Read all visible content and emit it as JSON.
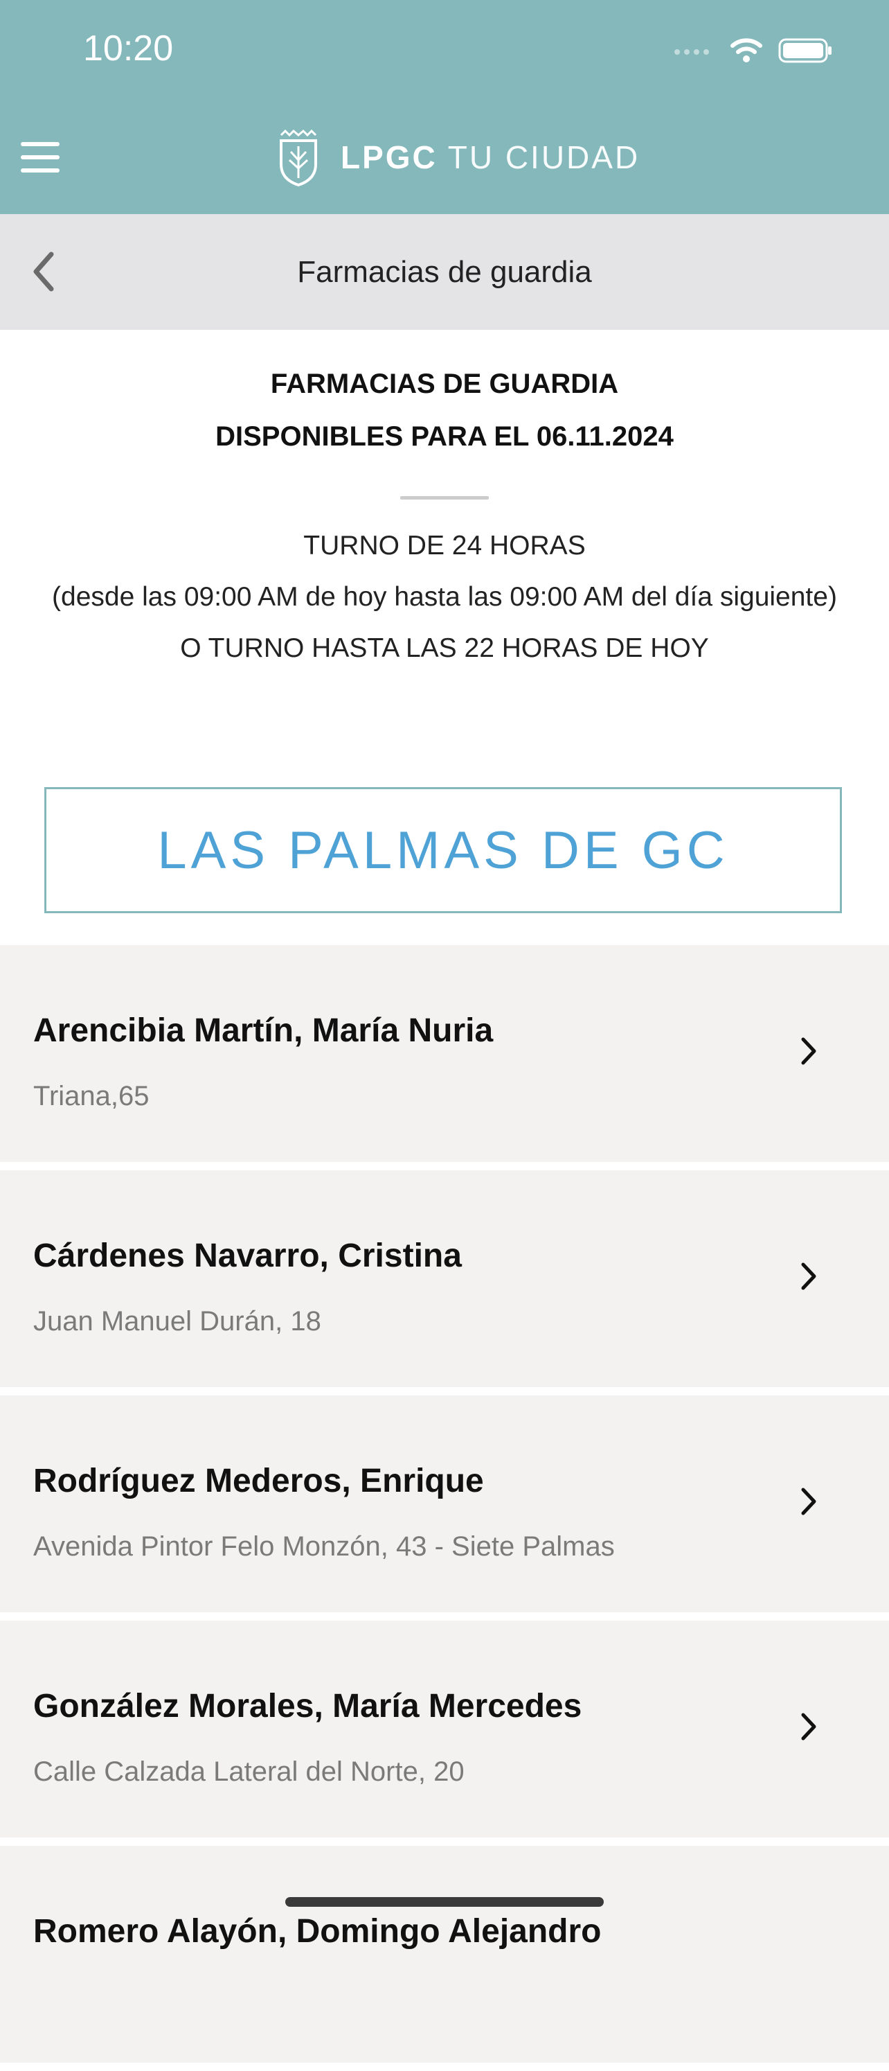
{
  "status_bar": {
    "time": "10:20",
    "icons": [
      "signal-icon",
      "wifi-icon",
      "battery-icon"
    ]
  },
  "header": {
    "brand_bold": "LPGC",
    "brand_light": "TU CIUDAD",
    "menu_icon": "menu-icon",
    "logo_icon": "shield-crest-icon"
  },
  "subheader": {
    "title": "Farmacias de guardia",
    "back_icon": "chevron-left-icon"
  },
  "intro": {
    "title_line1": "FARMACIAS DE GUARDIA",
    "title_line2": "DISPONIBLES PARA EL 06.11.2024",
    "shift_24h": "TURNO DE 24 HORAS",
    "shift_detail": "(desde las 09:00 AM de hoy hasta las 09:00 AM del día siguiente)",
    "shift_22h": "O TURNO HASTA LAS 22 HORAS DE HOY"
  },
  "city_button": {
    "label": "LAS PALMAS DE GC"
  },
  "pharmacies": [
    {
      "name": "Arencibia Martín, María Nuria",
      "address": "Triana,65"
    },
    {
      "name": "Cárdenes Navarro, Cristina",
      "address": "Juan Manuel Durán, 18"
    },
    {
      "name": "Rodríguez Mederos, Enrique",
      "address": "Avenida Pintor Felo Monzón, 43 - Siete Palmas"
    },
    {
      "name": "González Morales, María Mercedes",
      "address": "Calle Calzada Lateral del Norte, 20"
    },
    {
      "name": "Romero Alayón, Domingo Alejandro",
      "address": ""
    }
  ],
  "colors": {
    "header_bg": "#84b8ba",
    "subheader_bg": "#e4e4e6",
    "list_bg": "#f3f2f0",
    "city_text": "#4ea2d6"
  }
}
